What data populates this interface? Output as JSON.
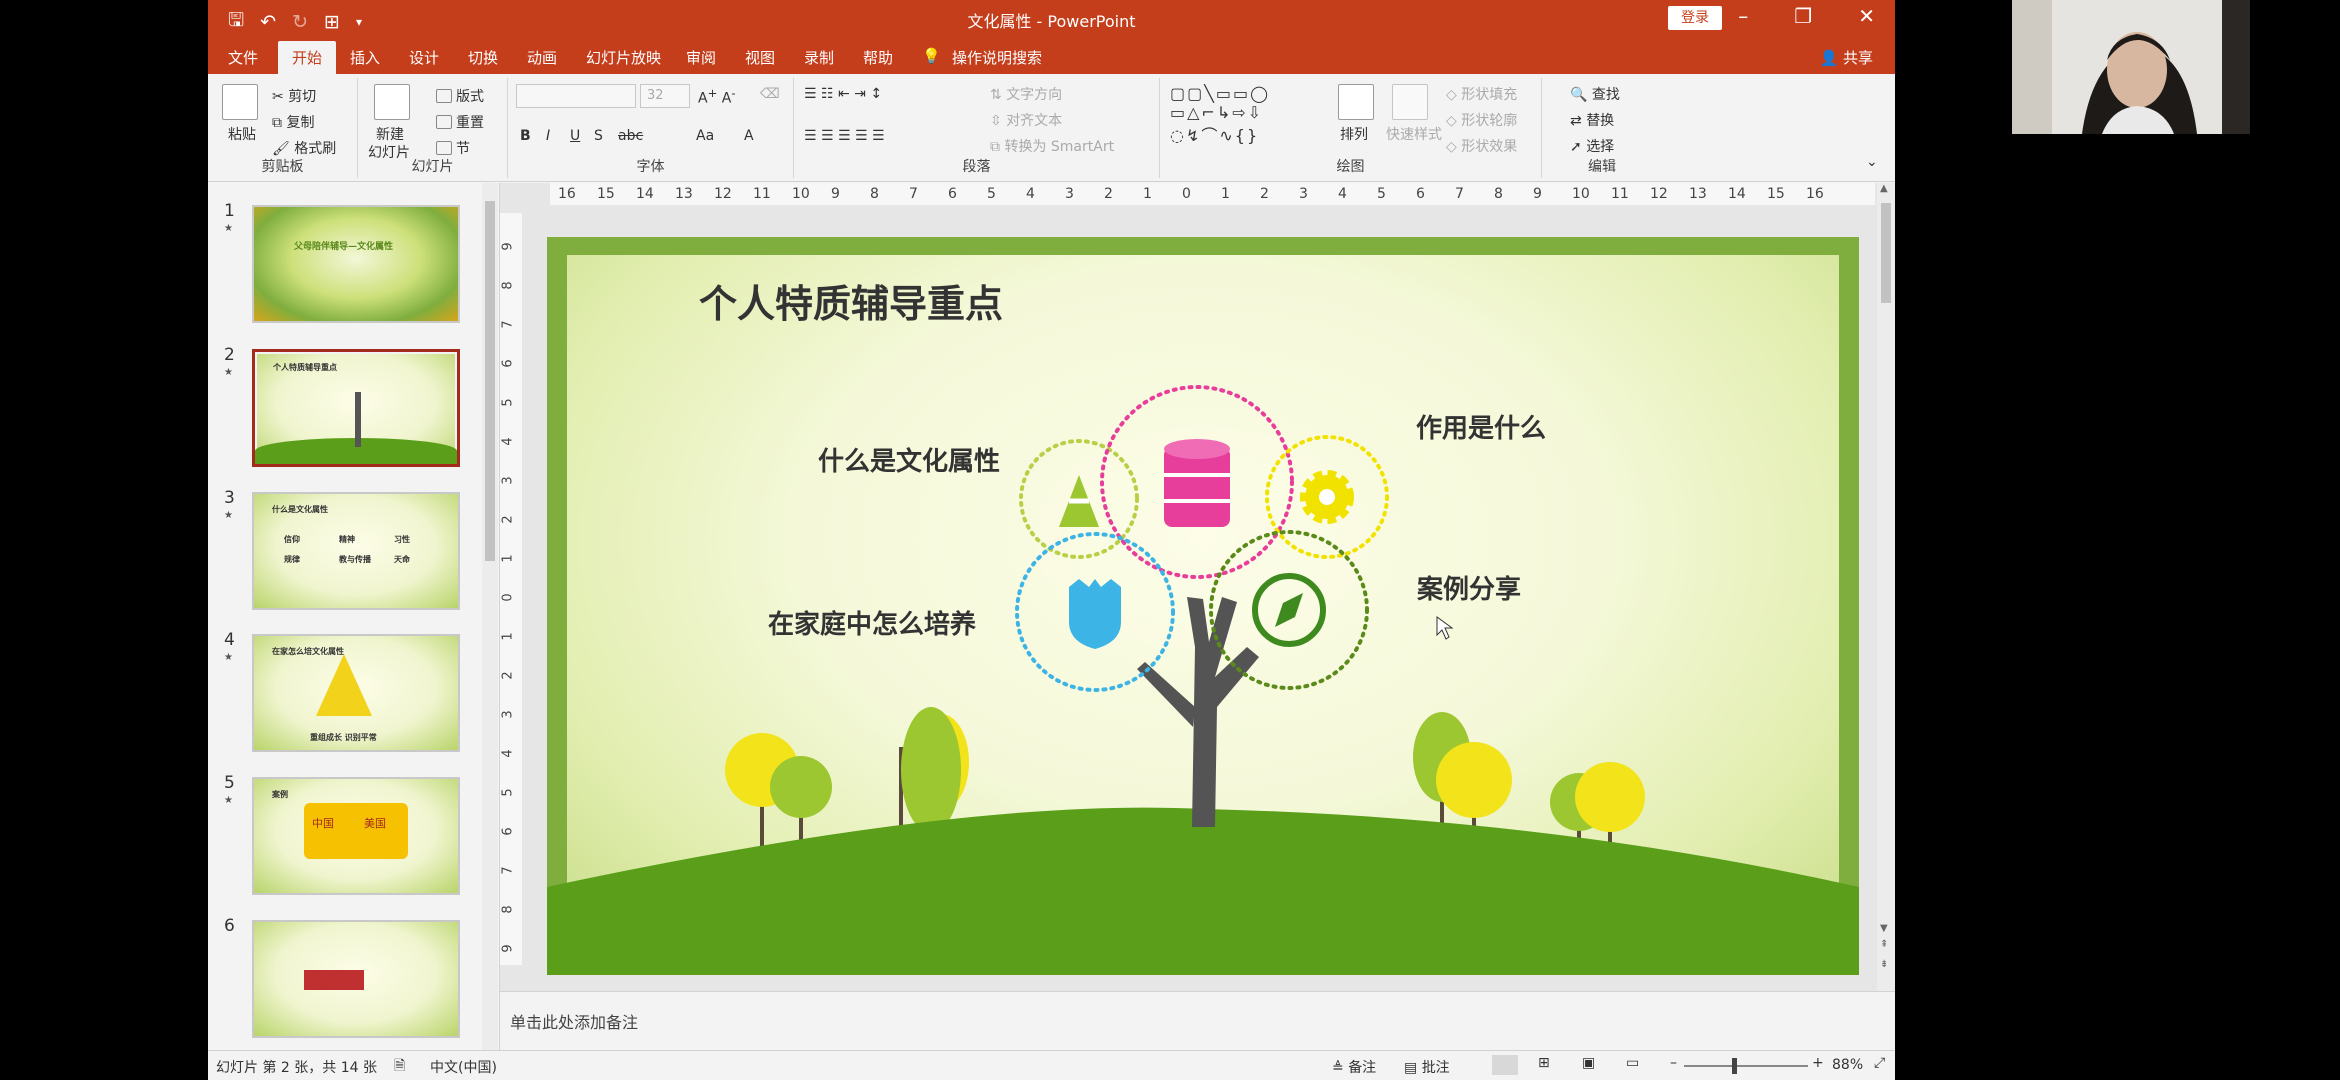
{
  "window": {
    "title": "文化属性 - PowerPoint",
    "login": "登录",
    "share": "共享"
  },
  "tabs": [
    "文件",
    "开始",
    "插入",
    "设计",
    "切换",
    "动画",
    "幻灯片放映",
    "审阅",
    "视图",
    "录制",
    "帮助",
    "操作说明搜索"
  ],
  "ribbon": {
    "clipboard": {
      "label": "剪贴板",
      "paste": "粘贴",
      "cut": "剪切",
      "copy": "复制",
      "format_painter": "格式刷"
    },
    "slides": {
      "label": "幻灯片",
      "new_slide_1": "新建",
      "new_slide_2": "幻灯片",
      "layout": "版式",
      "reset": "重置",
      "section": "节"
    },
    "font": {
      "label": "字体",
      "size": "32",
      "bold": "B",
      "italic": "I",
      "underline": "U",
      "shadow": "S",
      "strike": "abc",
      "case": "Aa",
      "color": "A"
    },
    "paragraph": {
      "label": "段落",
      "text_direction": "文字方向",
      "align_text": "对齐文本",
      "smartart": "转换为 SmartArt"
    },
    "drawing": {
      "label": "绘图",
      "arrange": "排列",
      "quick_styles": "快速样式",
      "shape_fill": "形状填充",
      "shape_outline": "形状轮廓",
      "shape_effects": "形状效果"
    },
    "editing": {
      "label": "编辑",
      "find": "查找",
      "replace": "替换",
      "select": "选择"
    }
  },
  "ruler": {
    "h_ticks": [
      "16",
      "15",
      "14",
      "13",
      "12",
      "11",
      "10",
      "9",
      "8",
      "7",
      "6",
      "5",
      "4",
      "3",
      "2",
      "1",
      "0",
      "1",
      "2",
      "3",
      "4",
      "5",
      "6",
      "7",
      "8",
      "9",
      "10",
      "11",
      "12",
      "13",
      "14",
      "15",
      "16"
    ],
    "v_ticks": [
      "9",
      "8",
      "7",
      "6",
      "5",
      "4",
      "3",
      "2",
      "1",
      "0",
      "1",
      "2",
      "3",
      "4",
      "5",
      "6",
      "7",
      "8",
      "9"
    ]
  },
  "thumbnails": [
    {
      "num": "1",
      "star": "★",
      "title": "父母陪伴辅导—文化属性"
    },
    {
      "num": "2",
      "star": "★",
      "title": "个人特质辅导重点"
    },
    {
      "num": "3",
      "star": "★",
      "title": "什么是文化属性",
      "words": [
        "信仰",
        "精神",
        "习性",
        "规律",
        "教与传播",
        "天命"
      ]
    },
    {
      "num": "4",
      "star": "★",
      "title": "在家怎么培文化属性",
      "caption": "重组成长 识别平常"
    },
    {
      "num": "5",
      "star": "★",
      "title": "案例",
      "words": [
        "中国",
        "美国"
      ]
    },
    {
      "num": "6",
      "star": "",
      "title": ""
    }
  ],
  "slide": {
    "title": "个人特质辅导重点",
    "labels": {
      "what": "什么是文化属性",
      "role": "作用是什么",
      "home": "在家庭中怎么培养",
      "case": "案例分享"
    }
  },
  "notes_placeholder": "单击此处添加备注",
  "status": {
    "slide_info": "幻灯片 第 2 张，共 14 张",
    "language": "中文(中国)",
    "notes": "备注",
    "comments": "批注",
    "zoom": "88%"
  },
  "colors": {
    "accent": "#c43e1c",
    "green": "#5a9e1a",
    "pink": "#e83e9b",
    "blue": "#3db4e6",
    "yellow": "#f2e200"
  }
}
